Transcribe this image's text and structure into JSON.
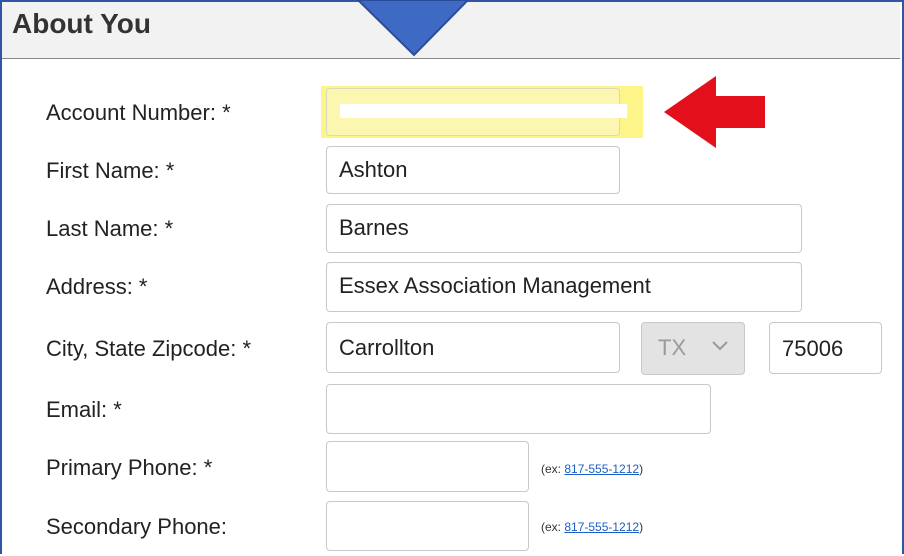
{
  "section": {
    "title": "About You"
  },
  "colors": {
    "frame": "#2f55a6",
    "pointer": "#3f6ac4",
    "arrow": "#e3101c",
    "highlight": "#fdf58a"
  },
  "form": {
    "account_number": {
      "label": "Account Number: *",
      "value": ""
    },
    "first_name": {
      "label": "First Name: *",
      "value": "Ashton"
    },
    "last_name": {
      "label": "Last Name: *",
      "value": "Barnes"
    },
    "address": {
      "label": "Address: *",
      "value": "Essex Association Management"
    },
    "city_state_zip": {
      "label": "City, State Zipcode: *",
      "city": "Carrollton",
      "state": "TX",
      "zip": "75006"
    },
    "email": {
      "label": "Email: *",
      "value": ""
    },
    "primary_phone": {
      "label": "Primary Phone: *",
      "value": "",
      "hint_prefix": "(ex: ",
      "hint_example": "817-555-1212",
      "hint_suffix": ")"
    },
    "secondary_phone": {
      "label": "Secondary Phone:",
      "value": "",
      "hint_prefix": "(ex: ",
      "hint_example": "817-555-1212",
      "hint_suffix": ")"
    }
  },
  "annotations": {
    "pointer_icon": "down-triangle-icon",
    "arrow_icon": "red-left-arrow-icon"
  }
}
